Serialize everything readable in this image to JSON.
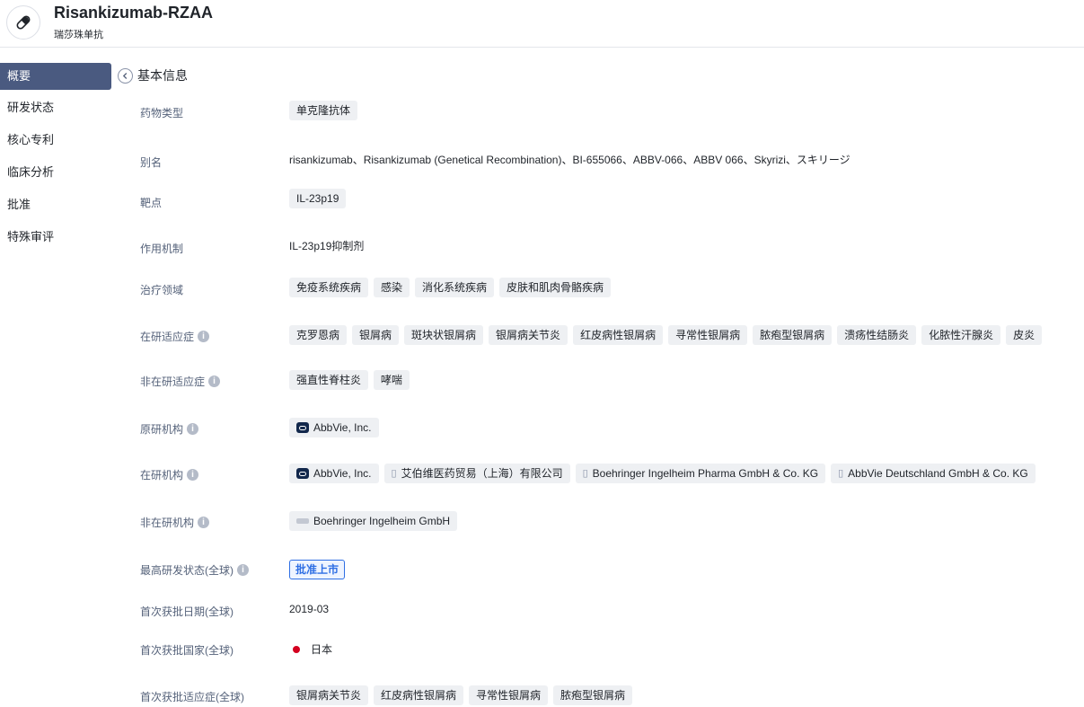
{
  "header": {
    "title": "Risankizumab-RZAA",
    "subtitle": "瑞莎珠单抗",
    "logo_icon": "pill-icon"
  },
  "sidebar": {
    "items": [
      {
        "label": "概要",
        "active": true
      },
      {
        "label": "研发状态"
      },
      {
        "label": "核心专利"
      },
      {
        "label": "临床分析"
      },
      {
        "label": "批准"
      },
      {
        "label": "特殊审评"
      }
    ]
  },
  "section": {
    "title": "基本信息"
  },
  "fields": {
    "drug_type": {
      "label": "药物类型",
      "chips": [
        "单克隆抗体"
      ]
    },
    "alias": {
      "label": "别名",
      "text": "risankizumab、Risankizumab (Genetical Recombination)、BI-655066、ABBV-066、ABBV 066、Skyrizi、スキリージ"
    },
    "target": {
      "label": "靶点",
      "chips": [
        "IL-23p19"
      ]
    },
    "mechanism": {
      "label": "作用机制",
      "text": "IL-23p19抑制剂"
    },
    "therapeutic_area": {
      "label": "治疗领域",
      "chips": [
        "免疫系统疾病",
        "感染",
        "消化系统疾病",
        "皮肤和肌肉骨骼疾病"
      ]
    },
    "active_indications": {
      "label": "在研适应症",
      "chips": [
        "克罗恩病",
        "银屑病",
        "斑块状银屑病",
        "银屑病关节炎",
        "红皮病性银屑病",
        "寻常性银屑病",
        "脓疱型银屑病",
        "溃疡性结肠炎",
        "化脓性汗腺炎",
        "皮炎"
      ]
    },
    "inactive_indications": {
      "label": "非在研适应症",
      "chips": [
        "强直性脊柱炎",
        "哮喘"
      ]
    },
    "originator": {
      "label": "原研机构",
      "orgs": [
        {
          "name": "AbbVie, Inc.",
          "icon": "abbvie-logo"
        }
      ]
    },
    "active_orgs": {
      "label": "在研机构",
      "orgs": [
        {
          "name": "AbbVie, Inc.",
          "icon": "abbvie-logo"
        },
        {
          "name": "艾伯维医药贸易（上海）有限公司",
          "icon": "building-icon"
        },
        {
          "name": "Boehringer Ingelheim Pharma GmbH & Co. KG",
          "icon": "building-icon"
        },
        {
          "name": "AbbVie Deutschland GmbH & Co. KG",
          "icon": "building-icon"
        }
      ]
    },
    "inactive_orgs": {
      "label": "非在研机构",
      "orgs": [
        {
          "name": "Boehringer Ingelheim GmbH",
          "icon": "boehringer-logo"
        }
      ]
    },
    "highest_status": {
      "label": "最高研发状态(全球)",
      "badge": "批准上市",
      "color": "#2f6fe4"
    },
    "first_approval_date": {
      "label": "首次获批日期(全球)",
      "text": "2019-03"
    },
    "first_approval_country": {
      "label": "首次获批国家(全球)",
      "text": "日本",
      "flag_color": "#d4001f"
    },
    "first_approval_indications": {
      "label": "首次获批适应症(全球)",
      "chips": [
        "银屑病关节炎",
        "红皮病性银屑病",
        "寻常性银屑病",
        "脓疱型银屑病"
      ]
    }
  }
}
